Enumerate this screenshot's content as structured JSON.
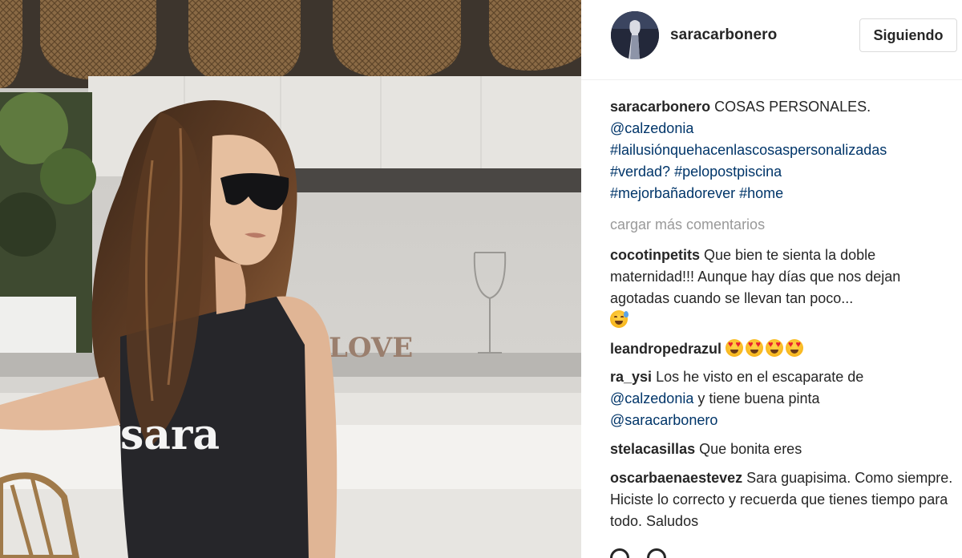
{
  "post": {
    "username": "saracarbonero",
    "follow_label": "Siguiendo",
    "shirt_text": "sara",
    "caption": {
      "username": "saracarbonero",
      "text": "COSAS PERSONALES.",
      "tags": [
        "@calzedonia",
        "#lailusiónquehacenlascosaspersonalizadas",
        "#verdad?",
        "#pelopostpiscina",
        "#mejorbañadorever",
        "#home"
      ]
    },
    "load_more": "cargar más comentarios",
    "comments": [
      {
        "username": "cocotinpetits",
        "text": "Que bien te sienta la doble maternidad!!! Aunque hay días que nos dejan agotadas cuando se llevan tan poco...",
        "emoji": "sweat-smile-icon"
      },
      {
        "username": "leandropedrazul",
        "text": "",
        "emoji": "heart-eyes-icon x4"
      },
      {
        "username": "ra_ysi",
        "text": "Los he visto en el escaparate de",
        "mention1": "@calzedonia",
        "text2": "y tiene buena pinta",
        "mention2": "@saracarbonero"
      },
      {
        "username": "stelacasillas",
        "text": "Que bonita eres"
      },
      {
        "username": "oscarbaenaestevez",
        "text": "Sara guapisima. Como siempre. Hiciste lo correcto y recuerda que tienes tiempo para todo. Saludos"
      }
    ]
  },
  "colors": {
    "text": "#262626",
    "link": "#003569",
    "muted": "#999999",
    "border": "#dbdbdb"
  }
}
